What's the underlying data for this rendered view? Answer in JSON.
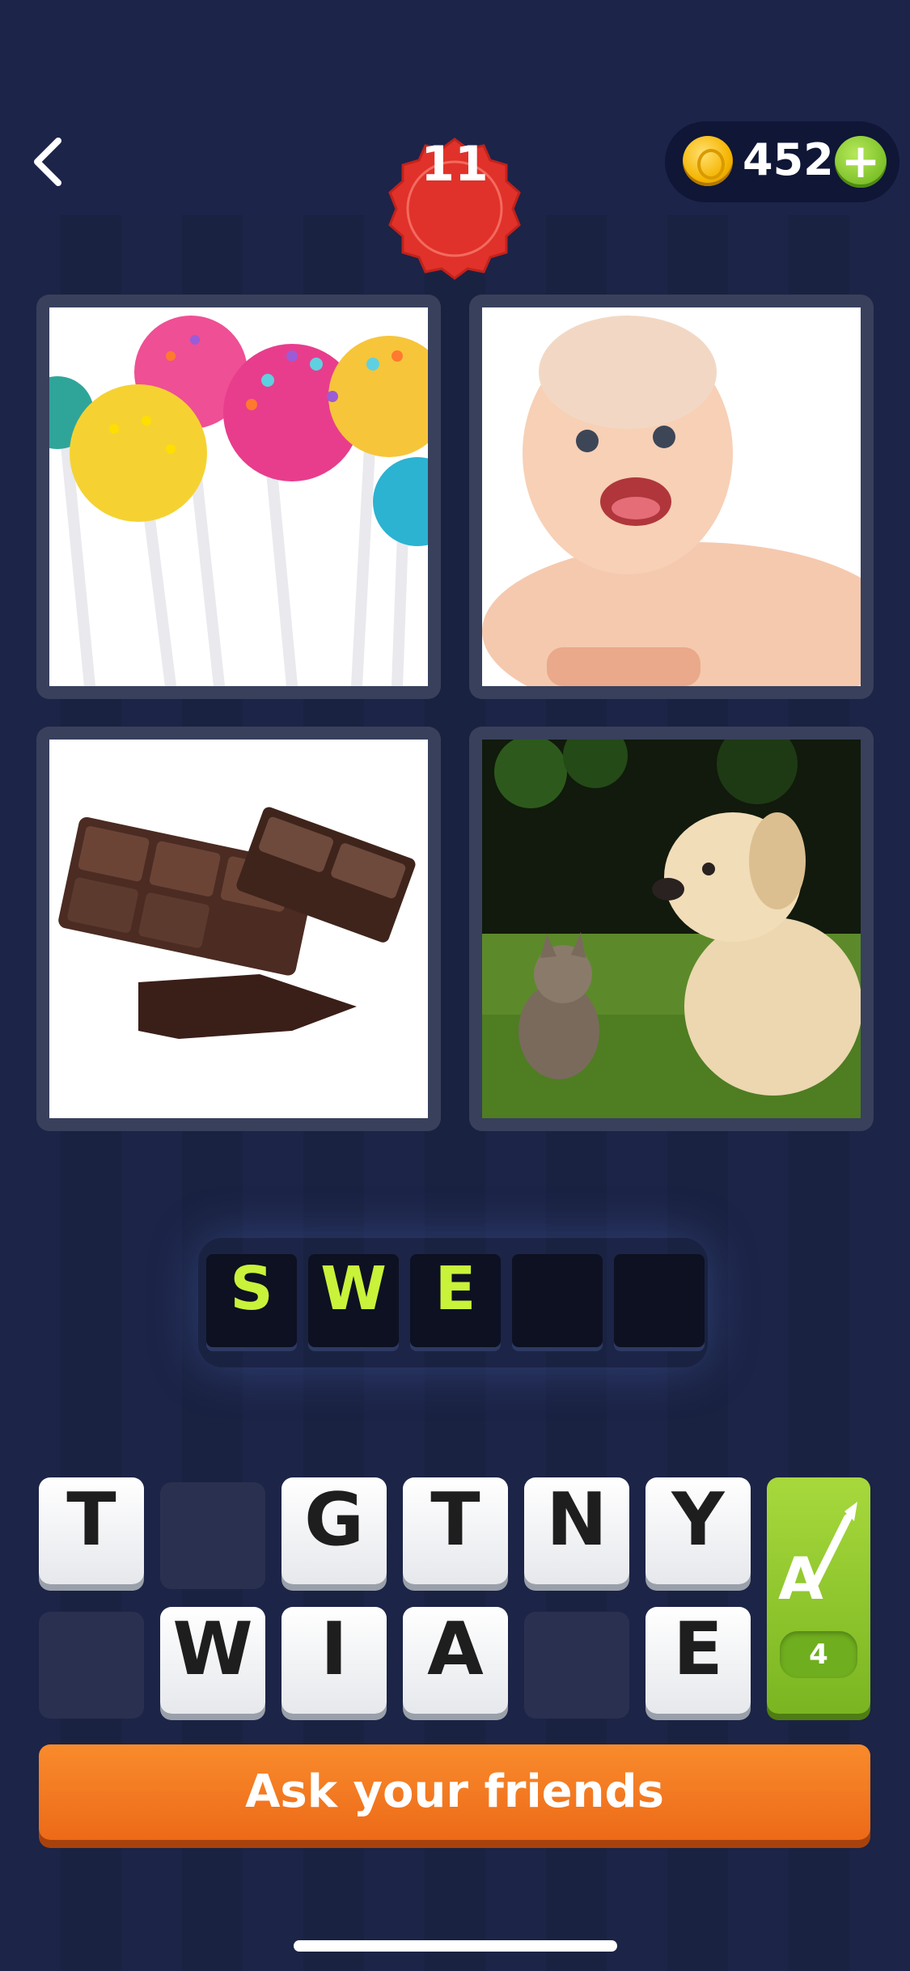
{
  "header": {
    "coins": "452",
    "plus_label": "+",
    "level": "11"
  },
  "images": [
    {
      "name": "cake-pops",
      "description": "colorful lollipop cake pops"
    },
    {
      "name": "baby",
      "description": "smiling baby"
    },
    {
      "name": "chocolate",
      "description": "chocolate bar pieces"
    },
    {
      "name": "puppy-kitten",
      "description": "puppy and kitten on grass"
    }
  ],
  "answer": {
    "letters": [
      "S",
      "W",
      "E",
      "",
      ""
    ]
  },
  "keyboard": {
    "row1": [
      "T",
      "",
      "G",
      "T",
      "N",
      "Y"
    ],
    "row2": [
      "",
      "W",
      "I",
      "A",
      "",
      "E"
    ],
    "hint_count": "4"
  },
  "ask_button": "Ask your friends",
  "colors": {
    "background": "#1c2447",
    "slot_letter": "#c9f23a",
    "level_badge": "#e0322a",
    "ask_button": "#f47b22",
    "hint_button": "#8cc63f"
  },
  "icons": [
    "back-chevron-icon",
    "coin-icon",
    "plus-icon",
    "paintbrush-hint-icon"
  ]
}
